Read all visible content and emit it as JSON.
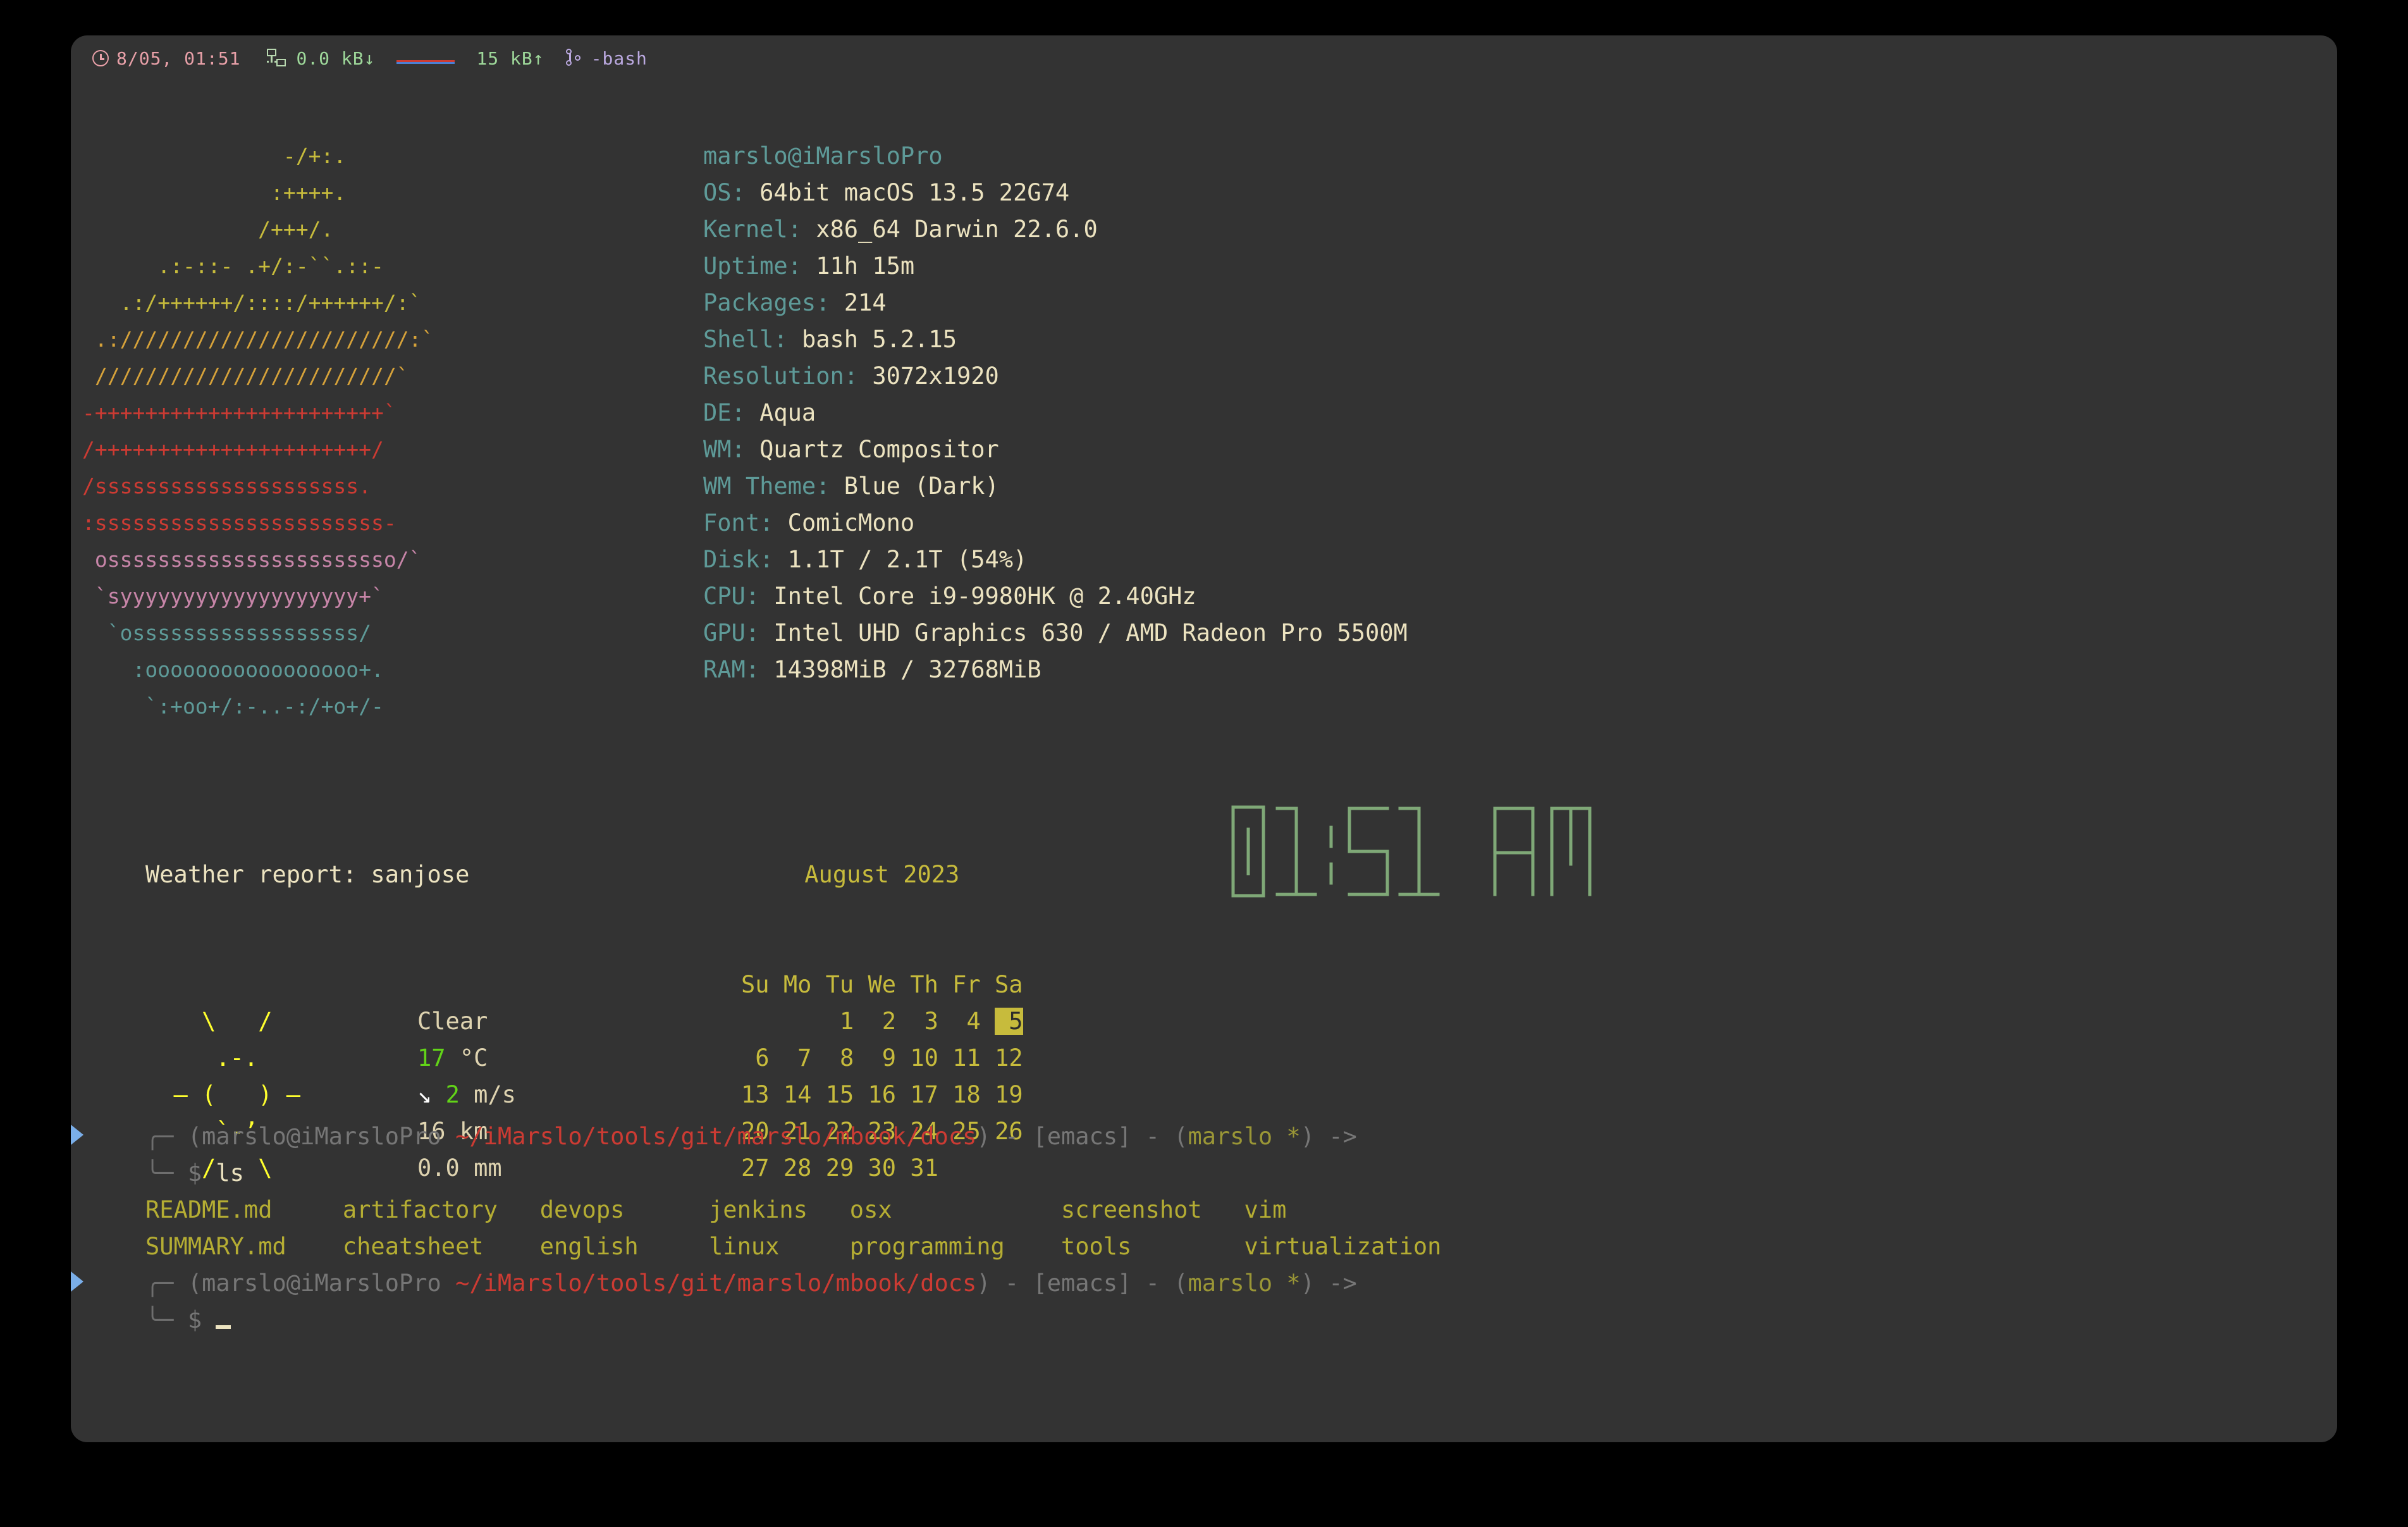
{
  "window": {
    "background_color": "#333333",
    "desktop_color": "#000000"
  },
  "statusbar": {
    "clock_icon": "clock-icon",
    "datetime": "8/05, 01:51",
    "network_icon": "network-icon",
    "download_rate": "0.0 kB↓",
    "upload_rate": "15 kB↑",
    "sparkline_icon": "network-sparkline",
    "git_icon": "git-branch-icon",
    "shell_name": "-bash"
  },
  "neofetch": {
    "ascii_art_lines": [
      {
        "text": "                -/+:.",
        "color": "#c7bb3c"
      },
      {
        "text": "               :++++.",
        "color": "#c7bb3c"
      },
      {
        "text": "              /+++/.",
        "color": "#c7bb3c"
      },
      {
        "text": "      .:-::- .+/:-``.::-",
        "color": "#c7bb3c"
      },
      {
        "text": "   .:/++++++/::::/++++++/:`",
        "color": "#c7bb3c"
      },
      {
        "text": " .:///////////////////////:`",
        "color": "#d6a23a"
      },
      {
        "text": " ////////////////////////`",
        "color": "#d6a23a"
      },
      {
        "text": "-+++++++++++++++++++++++`",
        "color": "#cc3b33"
      },
      {
        "text": "/++++++++++++++++++++++/",
        "color": "#cc3b33"
      },
      {
        "text": "/sssssssssssssssssssss.",
        "color": "#cc3b33"
      },
      {
        "text": ":sssssssssssssssssssssss-",
        "color": "#cc3b33"
      },
      {
        "text": " osssssssssssssssssssssso/`",
        "color": "#c785a8"
      },
      {
        "text": " `syyyyyyyyyyyyyyyyyyy+`",
        "color": "#c785a8"
      },
      {
        "text": "  `ossssssssssssssssss/",
        "color": "#5e9a98"
      },
      {
        "text": "    :ooooooooooooooooo+.",
        "color": "#5e9a98"
      },
      {
        "text": "     `:+oo+/:-..-:/+o+/-",
        "color": "#5e9a98"
      }
    ],
    "user_host": "marslo@iMarsloPro",
    "user": "marslo",
    "host": "iMarsloPro",
    "info": [
      {
        "key": "OS",
        "value": "64bit macOS 13.5 22G74"
      },
      {
        "key": "Kernel",
        "value": "x86_64 Darwin 22.6.0"
      },
      {
        "key": "Uptime",
        "value": "11h 15m"
      },
      {
        "key": "Packages",
        "value": "214"
      },
      {
        "key": "Shell",
        "value": "bash 5.2.15"
      },
      {
        "key": "Resolution",
        "value": "3072x1920"
      },
      {
        "key": "DE",
        "value": "Aqua"
      },
      {
        "key": "WM",
        "value": "Quartz Compositor"
      },
      {
        "key": "WM Theme",
        "value": "Blue (Dark)"
      },
      {
        "key": "Font",
        "value": "ComicMono"
      },
      {
        "key": "Disk",
        "value": "1.1T / 2.1T (54%)"
      },
      {
        "key": "CPU",
        "value": "Intel Core i9-9980HK @ 2.40GHz"
      },
      {
        "key": "GPU",
        "value": "Intel UHD Graphics 630 / AMD Radeon Pro 5500M"
      },
      {
        "key": "RAM",
        "value": "14398MiB / 32768MiB"
      }
    ]
  },
  "weather": {
    "title": "Weather report: sanjose",
    "location": "sanjose",
    "art_lines": [
      "    \\   /   ",
      "     .-.    ",
      "  ― (   ) ― ",
      "     `-’    ",
      "    /   \\   "
    ],
    "condition": "Clear",
    "temperature": "17 °C",
    "temperature_value": "17",
    "temperature_unit": "°C",
    "wind_arrow": "↘",
    "wind_speed": "2",
    "wind_unit": "m/s",
    "visibility": "16 km",
    "precipitation": "0.0 mm"
  },
  "calendar": {
    "title": "August 2023",
    "month": "August",
    "year": "2023",
    "weekdays": [
      "Su",
      "Mo",
      "Tu",
      "We",
      "Th",
      "Fr",
      "Sa"
    ],
    "weeks": [
      [
        "",
        "",
        "1",
        "2",
        "3",
        "4",
        "5"
      ],
      [
        "6",
        "7",
        "8",
        "9",
        "10",
        "11",
        "12"
      ],
      [
        "13",
        "14",
        "15",
        "16",
        "17",
        "18",
        "19"
      ],
      [
        "20",
        "21",
        "22",
        "23",
        "24",
        "25",
        "26"
      ],
      [
        "27",
        "28",
        "29",
        "30",
        "31",
        "",
        ""
      ]
    ],
    "today": "5",
    "highlight_color": "#c7bb3c"
  },
  "bigclock": {
    "time": "01:51",
    "meridiem": "AM",
    "display": "01:51 AM",
    "color": "#7fa877"
  },
  "shell": {
    "prompt": {
      "top_prefix": "╭─",
      "bottom_prefix": "╰─",
      "open_paren": "(",
      "user_host": "marslo@iMarsloPro",
      "path": "~/iMarslo/tools/git/marslo/mbook/docs",
      "close_paren": ")",
      "sep": " - ",
      "editor": "[emacs]",
      "git_open": "(",
      "git_branch": "marslo *",
      "git_close": ")",
      "arrow": " ->",
      "dollar": "$"
    },
    "entries": [
      {
        "command": "ls",
        "output_rows": [
          [
            "README.md",
            "artifactory",
            "devops",
            "jenkins",
            "osx",
            "screenshot",
            "vim"
          ],
          [
            "SUMMARY.md",
            "cheatsheet",
            "english",
            "linux",
            "programming",
            "tools",
            "virtualization"
          ]
        ]
      }
    ],
    "cursor": "_"
  }
}
